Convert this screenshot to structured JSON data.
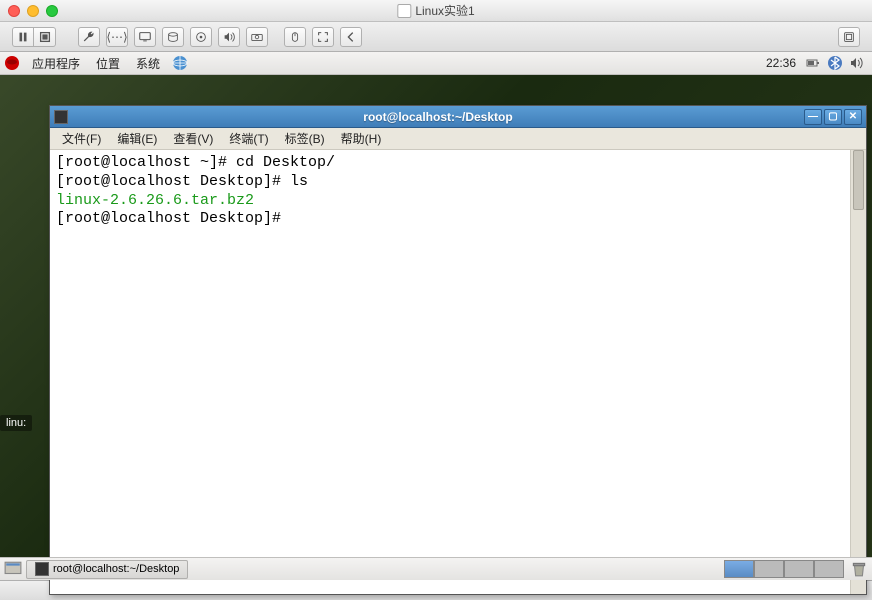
{
  "mac": {
    "title": "Linux实验1"
  },
  "gnome": {
    "menus": {
      "apps": "应用程序",
      "places": "位置",
      "system": "系统"
    },
    "time": "22:36"
  },
  "desktop": {
    "icon_label": "linu:"
  },
  "terminal": {
    "title": "root@localhost:~/Desktop",
    "menus": {
      "file": "文件(F)",
      "edit": "编辑(E)",
      "view": "查看(V)",
      "terminal": "终端(T)",
      "tabs": "标签(B)",
      "help": "帮助(H)"
    },
    "lines": [
      {
        "text": "[root@localhost ~]# cd Desktop/",
        "class": ""
      },
      {
        "text": "[root@localhost Desktop]# ls",
        "class": ""
      },
      {
        "text": "linux-2.6.26.6.tar.bz2",
        "class": "term-green"
      },
      {
        "text": "[root@localhost Desktop]# ",
        "class": ""
      }
    ]
  },
  "taskbar": {
    "item": "root@localhost:~/Desktop"
  }
}
